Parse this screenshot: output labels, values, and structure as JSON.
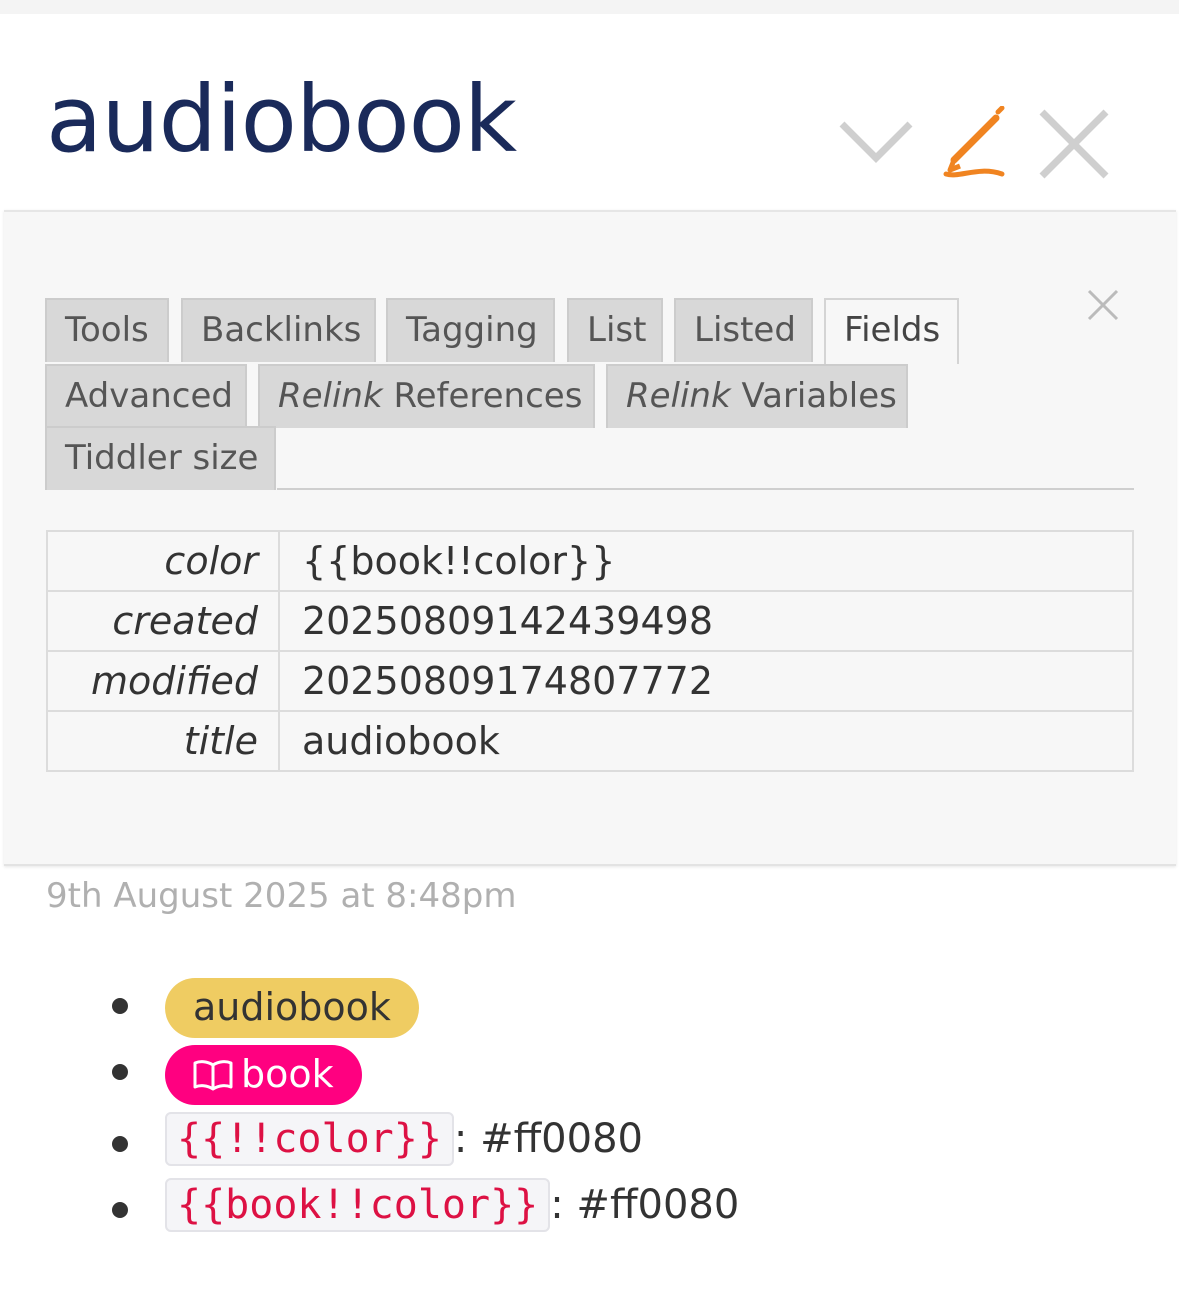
{
  "tiddler": {
    "title": "audiobook",
    "controls": {
      "more_icon": "chevron-down-icon",
      "edit_icon": "pencil-icon",
      "close_icon": "close-icon",
      "edit_color": "#f08421"
    }
  },
  "info": {
    "tabs_row1": [
      "Tools",
      "Backlinks",
      "Tagging",
      "List",
      "Listed",
      "Fields"
    ],
    "tabs_row2": [
      {
        "prefix": "",
        "label": "Advanced"
      },
      {
        "prefix": "Relink",
        "label": " References"
      },
      {
        "prefix": "Relink",
        "label": " Variables"
      }
    ],
    "tabs_row3": [
      "Tiddler size"
    ],
    "active_tab": "Fields",
    "fields": [
      {
        "name": "color",
        "value": "{{book!!color}}"
      },
      {
        "name": "created",
        "value": "20250809142439498"
      },
      {
        "name": "modified",
        "value": "20250809174807772"
      },
      {
        "name": "title",
        "value": "audiobook"
      }
    ]
  },
  "subtitle": "9th August 2025 at 8:48pm",
  "body": {
    "tags": [
      {
        "label": "audiobook",
        "color": "#efcc62"
      },
      {
        "label": "book",
        "color": "#ff0080",
        "icon": "book-icon"
      }
    ],
    "code_items": [
      {
        "code": "{{!!color}}",
        "result": ": #ff0080"
      },
      {
        "code": "{{book!!color}}",
        "result": ": #ff0080"
      }
    ]
  }
}
